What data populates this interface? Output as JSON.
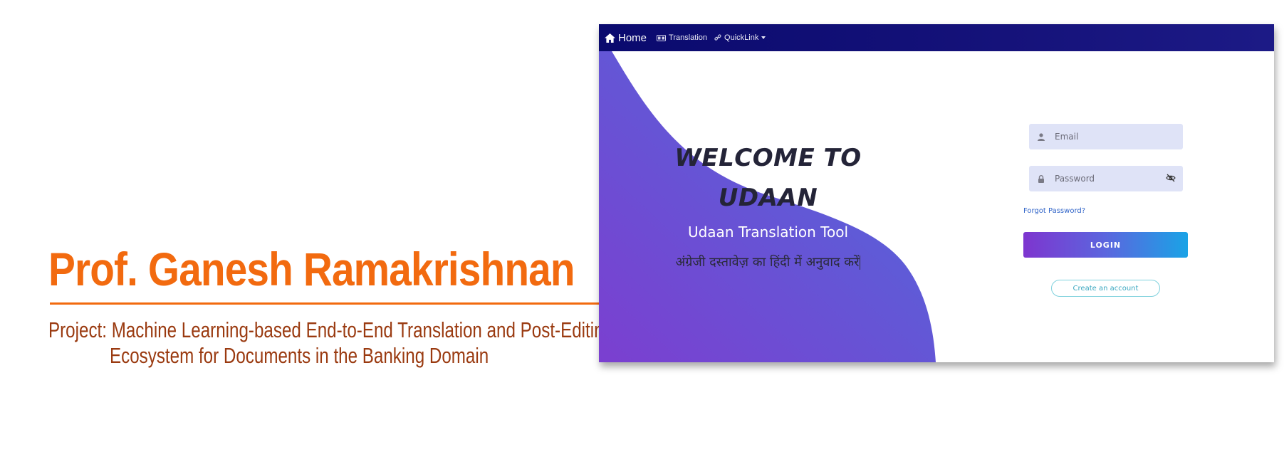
{
  "slide": {
    "presenter": "Prof. Ganesh Ramakrishnan",
    "project_line1": "Project: Machine Learning-based End-to-End Translation and Post-Editing",
    "project_line2": "Ecosystem for Documents in the Banking Domain",
    "accent_color": "#f26a0f",
    "subtitle_color": "#9a3a10"
  },
  "navbar": {
    "home": "Home",
    "translation": "Translation",
    "quicklink": "QuickLink",
    "home_icon": "home-icon",
    "translation_icon": "language-icon",
    "quicklink_icon": "link-icon"
  },
  "hero": {
    "welcome_line1": "WELCOME TO",
    "welcome_line2": "UDAAN",
    "tool_title": "Udaan Translation Tool",
    "hindi_text": "अंग्रेजी दस्तावेज़ का हिंदी में अनुवाद करें"
  },
  "login": {
    "email_placeholder": "Email",
    "password_placeholder": "Password",
    "forgot": "Forgot Password?",
    "login_label": "LOGIN",
    "create_label": "Create an account"
  }
}
